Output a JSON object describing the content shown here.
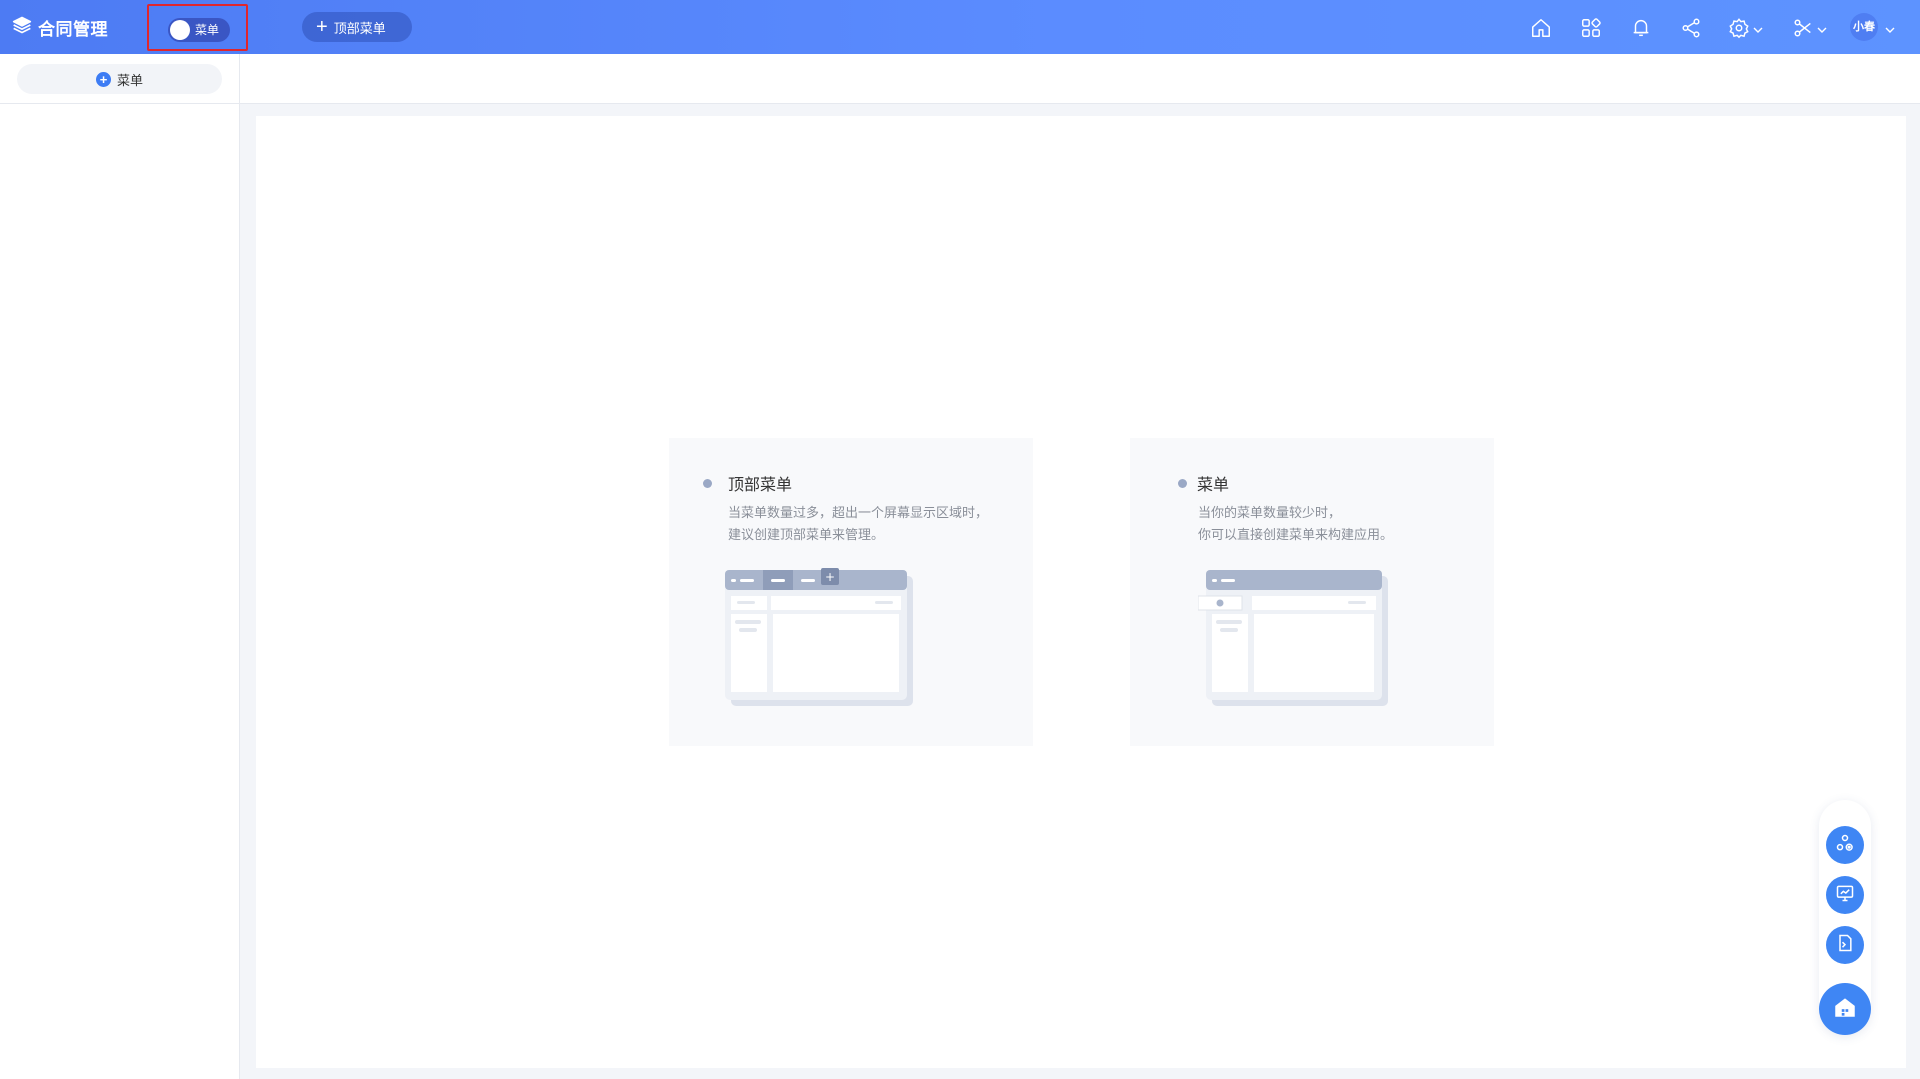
{
  "app": {
    "title": "合同管理",
    "toggle_label": "菜单",
    "top_menu_button": "顶部菜单",
    "user_name": "小春"
  },
  "header_icons": [
    "home-icon",
    "apps-icon",
    "bell-icon",
    "share-icon",
    "settings-icon",
    "tools-icon"
  ],
  "sidebar": {
    "add_menu_label": "菜单"
  },
  "cards": [
    {
      "title": "顶部菜单",
      "desc_line1": "当菜单数量过多，超出一个屏幕显示区域时，",
      "desc_line2": "建议创建顶部菜单来管理。"
    },
    {
      "title": "菜单",
      "desc_line1": "当你的菜单数量较少时，",
      "desc_line2": "你可以直接创建菜单来构建应用。"
    }
  ],
  "floating_actions": [
    "app-settings-icon",
    "dashboard-icon",
    "script-icon",
    "home-building-icon"
  ],
  "colors": {
    "header_gradient_start": "#4d7bf3",
    "header_gradient_end": "#5d93ff",
    "accent": "#3f86f4",
    "highlight_box": "#e0262d"
  }
}
